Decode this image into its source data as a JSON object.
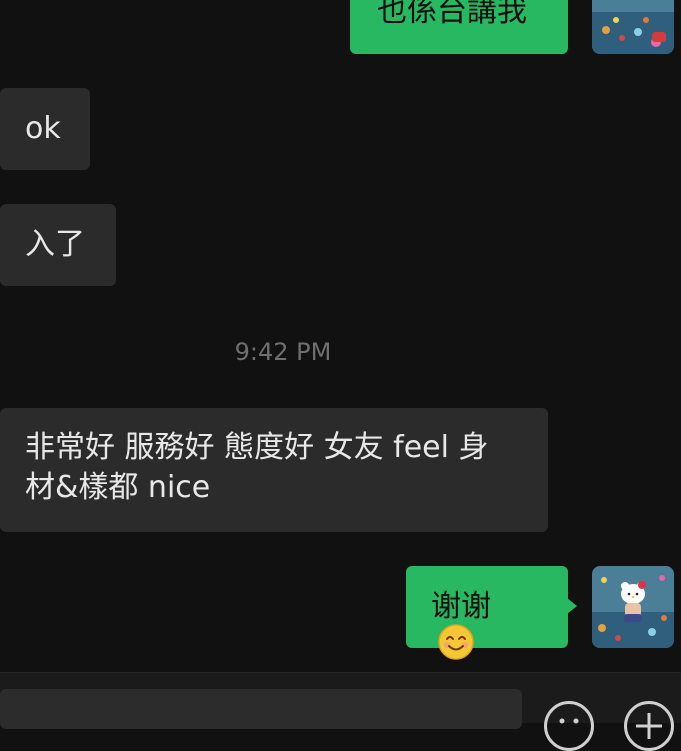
{
  "messages": {
    "top_partial_text": "也係台講我",
    "ok_text": "ok",
    "joined_text": "入了",
    "timestamp": "9:42 PM",
    "review_line1": "非常好 服務好 態度好 女友 feel 身",
    "review_line2": "材&樣都 nice",
    "thanks_text": "谢谢"
  },
  "icons": {
    "emoji": "smiling-face-emoji",
    "left_input_button": "emoji-face-icon",
    "right_input_button": "add-icon"
  },
  "colors": {
    "background": "#111111",
    "incoming_bubble": "#2b2b2b",
    "outgoing_bubble": "#29b862",
    "timestamp_text": "#6f6f6f"
  }
}
